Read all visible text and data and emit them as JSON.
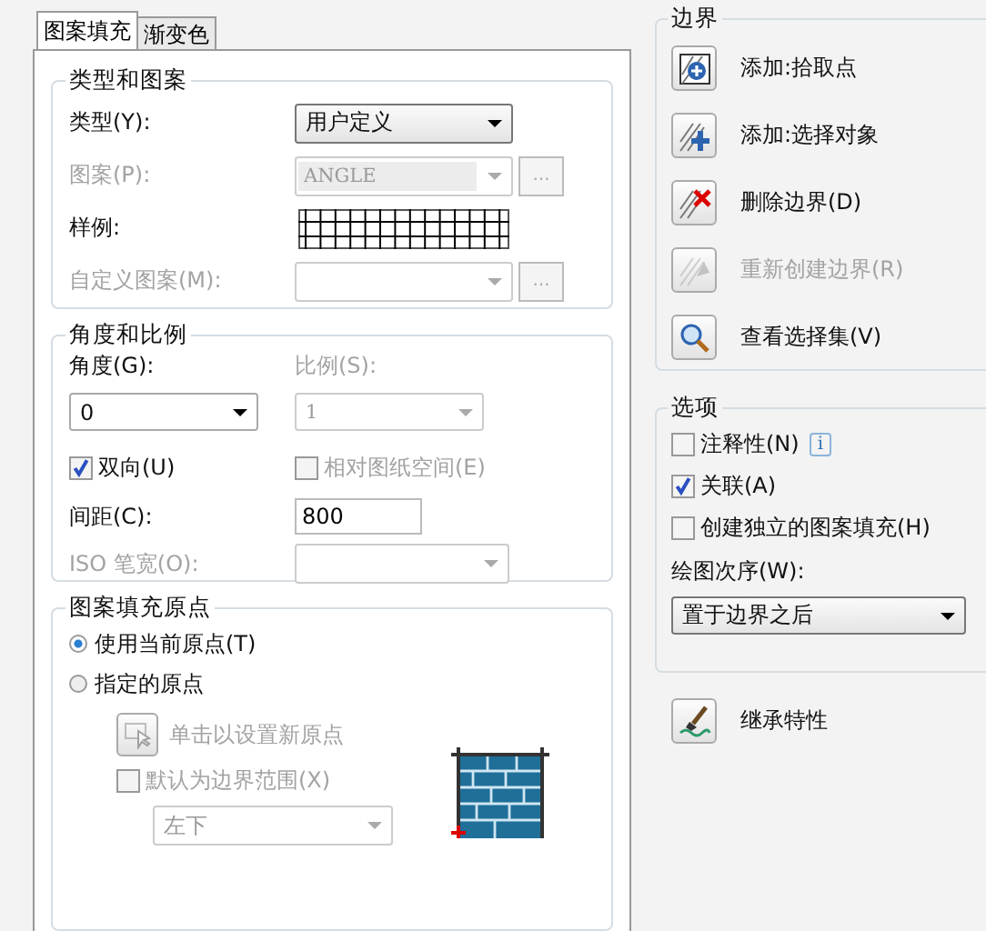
{
  "tabs": [
    {
      "label": "图案填充",
      "selected": true
    },
    {
      "label": "渐变色",
      "selected": false
    }
  ],
  "type_and_pattern": {
    "title": "类型和图案",
    "rows": [
      {
        "kind": "dropdown",
        "label": "类型(Y):",
        "value": "用户定义",
        "disabled": false
      },
      {
        "kind": "dropdown_browse",
        "label": "图案(P):",
        "value": "ANGLE",
        "button": "...",
        "disabled": true
      },
      {
        "kind": "swatch",
        "label": "样例:",
        "disabled": false
      },
      {
        "kind": "dropdown_browse",
        "label": "自定义图案(M):",
        "button": "...",
        "disabled": true
      }
    ]
  },
  "angle_and_scale": {
    "title": "角度和比例",
    "angle": {
      "label": "角度(G):",
      "value": "0"
    },
    "scale": {
      "label": "比例(S):",
      "value": "1",
      "disabled": true
    },
    "checks": [
      {
        "label": "双向(U)",
        "checked": true,
        "disabled": false
      },
      {
        "label": "相对图纸空间(E)",
        "checked": false,
        "disabled": true
      }
    ],
    "spacing": {
      "label": "间距(C):",
      "value": "800"
    },
    "iso_pen": {
      "label": "ISO 笔宽(O):",
      "disabled": true
    }
  },
  "origin": {
    "title": "图案填充原点",
    "radios": [
      {
        "label": "使用当前原点(T)",
        "selected": true
      },
      {
        "label": "指定的原点",
        "selected": false
      }
    ],
    "pick_button": {
      "label": "单击以设置新原点",
      "disabled": true
    },
    "default_extents": {
      "label": "默认为边界范围(X)",
      "checked": false,
      "disabled": true
    },
    "position": {
      "value": "左下",
      "disabled": true
    }
  },
  "boundaries": {
    "title": "边界",
    "buttons": [
      {
        "kind": "pick_points",
        "label": "添加:拾取点",
        "disabled": false
      },
      {
        "kind": "select_objects",
        "label": "添加:选择对象",
        "disabled": false
      },
      {
        "kind": "remove",
        "label": "删除边界(D)",
        "disabled": false
      },
      {
        "kind": "recreate",
        "label": "重新创建边界(R)",
        "disabled": true
      },
      {
        "kind": "view",
        "label": "查看选择集(V)",
        "disabled": false
      }
    ]
  },
  "options": {
    "title": "选项",
    "checks": [
      {
        "label": "注释性(N)",
        "checked": false,
        "info": "i"
      },
      {
        "label": "关联(A)",
        "checked": true
      },
      {
        "label": "创建独立的图案填充(H)",
        "checked": false
      }
    ],
    "draw_order": {
      "label": "绘图次序(W):",
      "value": "置于边界之后"
    }
  },
  "inherit": {
    "label": "继承特性"
  }
}
